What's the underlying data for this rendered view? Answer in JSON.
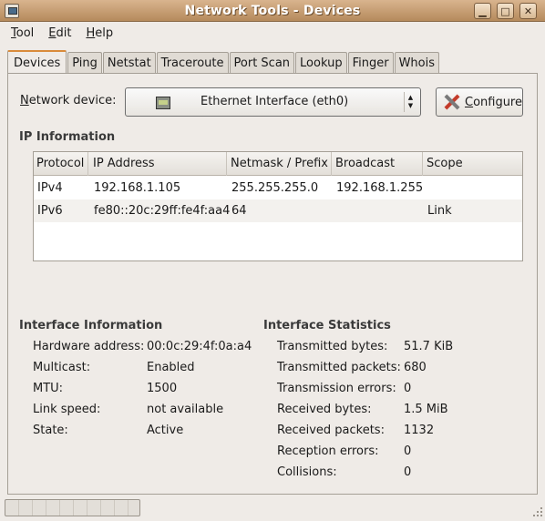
{
  "window": {
    "title": "Network Tools - Devices",
    "buttons": {
      "minimize": "▁",
      "maximize": "□",
      "close": "✕"
    }
  },
  "menu": [
    {
      "mnemonic": "T",
      "rest": "ool"
    },
    {
      "mnemonic": "E",
      "rest": "dit"
    },
    {
      "mnemonic": "H",
      "rest": "elp"
    }
  ],
  "tabs": [
    "Devices",
    "Ping",
    "Netstat",
    "Traceroute",
    "Port Scan",
    "Lookup",
    "Finger",
    "Whois"
  ],
  "device": {
    "label_mnemonic": "N",
    "label_rest": "etwork device:",
    "selected": "Ethernet Interface (eth0)",
    "icon": "ethernet-card-icon",
    "configure_mnemonic": "C",
    "configure_rest": "onfigure"
  },
  "ip_info": {
    "title": "IP Information",
    "columns": [
      "Protocol",
      "IP Address",
      "Netmask / Prefix",
      "Broadcast",
      "Scope"
    ],
    "rows": [
      [
        "IPv4",
        "192.168.1.105",
        "255.255.255.0",
        "192.168.1.255",
        ""
      ],
      [
        "IPv6",
        "fe80::20c:29ff:fe4f:aa4",
        "64",
        "",
        "Link"
      ]
    ]
  },
  "interface_info": {
    "title": "Interface Information",
    "items": [
      {
        "label": "Hardware address:",
        "value": "00:0c:29:4f:0a:a4"
      },
      {
        "label": "Multicast:",
        "value": "Enabled"
      },
      {
        "label": "MTU:",
        "value": "1500"
      },
      {
        "label": "Link speed:",
        "value": "not available"
      },
      {
        "label": "State:",
        "value": "Active"
      }
    ]
  },
  "interface_stats": {
    "title": "Interface Statistics",
    "items": [
      {
        "label": "Transmitted bytes:",
        "value": "51.7 KiB"
      },
      {
        "label": "Transmitted packets:",
        "value": "680"
      },
      {
        "label": "Transmission errors:",
        "value": "0"
      },
      {
        "label": "Received bytes:",
        "value": "1.5 MiB"
      },
      {
        "label": "Received packets:",
        "value": "1132"
      },
      {
        "label": "Reception errors:",
        "value": "0"
      },
      {
        "label": "Collisions:",
        "value": "0"
      }
    ]
  },
  "colors": {
    "titlebar": "#c49a6c",
    "active_tab_accent": "#d98b3a",
    "background": "#efebe7"
  }
}
